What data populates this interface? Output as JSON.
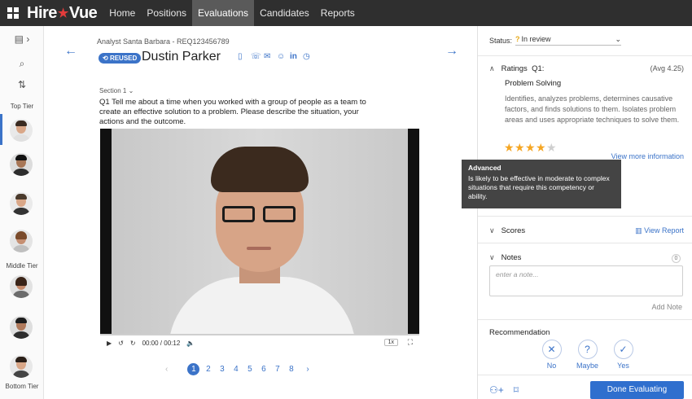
{
  "app": {
    "brand": {
      "left": "Hire",
      "star": "★",
      "right": "Vue"
    },
    "nav": [
      "Home",
      "Positions",
      "Evaluations",
      "Candidates",
      "Reports"
    ],
    "active_nav": "Evaluations"
  },
  "rail": {
    "tiers": [
      "Top Tier",
      "Middle Tier",
      "Bottom Tier"
    ]
  },
  "candidate": {
    "requisition": "Analyst Santa Barbara - REQ123456789",
    "badge": "REUSED",
    "name": "Dustin Parker",
    "section": "Section 1",
    "question": "Q1 Tell me about a time when you worked with a group of people as a team to create an effective solution to a problem. Please describe the situation, your actions and the outcome."
  },
  "player": {
    "time": "00:00 / 00:12",
    "speed": "1x"
  },
  "pager": {
    "pages": [
      "1",
      "2",
      "3",
      "4",
      "5",
      "6",
      "7",
      "8"
    ],
    "current": "1"
  },
  "panel": {
    "status_label": "Status:",
    "status_value": "In review",
    "ratings_label": "Ratings",
    "ratings_q": "Q1:",
    "avg": "(Avg 4.25)",
    "competency": "Problem Solving",
    "competency_desc": "Identifies, analyzes problems, determines causative factors, and finds solutions to them. Isolates problem areas and uses appropriate techniques to solve them.",
    "stars_filled": 4,
    "stars_total": 5,
    "star_color": "#f5a623",
    "view_more": "View more information",
    "tooltip_title": "Advanced",
    "tooltip_body": "Is likely to be effective in moderate to complex situations that require this competency or ability.",
    "scores_label": "Scores",
    "view_report": "View Report",
    "notes_label": "Notes",
    "notes_count": "0",
    "notes_placeholder": "enter a note...",
    "add_note": "Add Note",
    "recommendation_label": "Recommendation",
    "rec_options": [
      {
        "icon": "✕",
        "label": "No"
      },
      {
        "icon": "?",
        "label": "Maybe"
      },
      {
        "icon": "✓",
        "label": "Yes"
      }
    ],
    "done_button": "Done Evaluating"
  },
  "colors": {
    "accent": "#3b73c8",
    "topbar": "#2f2f2f",
    "brand_star": "#e23b3b"
  }
}
